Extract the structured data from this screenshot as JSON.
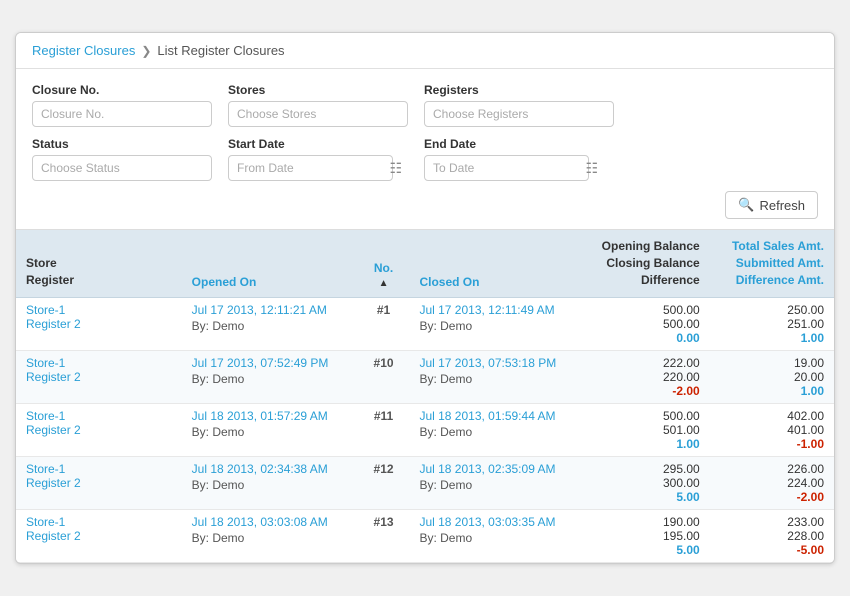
{
  "breadcrumb": {
    "link_label": "Register Closures",
    "separator": "❯",
    "current": "List Register Closures"
  },
  "filters": {
    "closure_no_label": "Closure No.",
    "closure_no_placeholder": "Closure No.",
    "stores_label": "Stores",
    "stores_placeholder": "Choose Stores",
    "registers_label": "Registers",
    "registers_placeholder": "Choose Registers",
    "status_label": "Status",
    "status_placeholder": "Choose Status",
    "start_date_label": "Start Date",
    "start_date_placeholder": "From Date",
    "end_date_label": "End Date",
    "end_date_placeholder": "To Date",
    "refresh_label": "Refresh"
  },
  "table": {
    "headers": {
      "store_register": "Store\nRegister",
      "opened_on": "Opened On",
      "no": "No.",
      "closed_on": "Closed On",
      "balance_lines": [
        "Opening Balance",
        "Closing Balance",
        "Difference"
      ],
      "sales_lines": [
        "Total Sales Amt.",
        "Submitted Amt.",
        "Difference Amt."
      ]
    },
    "rows": [
      {
        "store": "Store-1",
        "register": "Register 2",
        "opened_on": "Jul 17 2013, 12:11:21 AM",
        "opened_by": "By: Demo",
        "no": "#1",
        "closed_on": "Jul 17 2013, 12:11:49 AM",
        "closed_by": "By: Demo",
        "opening_balance": "500.00",
        "closing_balance": "500.00",
        "difference": "0.00",
        "difference_class": "green",
        "total_sales": "250.00",
        "submitted": "251.00",
        "diff_sales": "1.00",
        "diff_sales_class": "blue"
      },
      {
        "store": "Store-1",
        "register": "Register 2",
        "opened_on": "Jul 17 2013, 07:52:49 PM",
        "opened_by": "By: Demo",
        "no": "#10",
        "closed_on": "Jul 17 2013, 07:53:18 PM",
        "closed_by": "By: Demo",
        "opening_balance": "222.00",
        "closing_balance": "220.00",
        "difference": "-2.00",
        "difference_class": "red",
        "total_sales": "19.00",
        "submitted": "20.00",
        "diff_sales": "1.00",
        "diff_sales_class": "blue"
      },
      {
        "store": "Store-1",
        "register": "Register 2",
        "opened_on": "Jul 18 2013, 01:57:29 AM",
        "opened_by": "By: Demo",
        "no": "#11",
        "closed_on": "Jul 18 2013, 01:59:44 AM",
        "closed_by": "By: Demo",
        "opening_balance": "500.00",
        "closing_balance": "501.00",
        "difference": "1.00",
        "difference_class": "green",
        "total_sales": "402.00",
        "submitted": "401.00",
        "diff_sales": "-1.00",
        "diff_sales_class": "red"
      },
      {
        "store": "Store-1",
        "register": "Register 2",
        "opened_on": "Jul 18 2013, 02:34:38 AM",
        "opened_by": "By: Demo",
        "no": "#12",
        "closed_on": "Jul 18 2013, 02:35:09 AM",
        "closed_by": "By: Demo",
        "opening_balance": "295.00",
        "closing_balance": "300.00",
        "difference": "5.00",
        "difference_class": "green",
        "total_sales": "226.00",
        "submitted": "224.00",
        "diff_sales": "-2.00",
        "diff_sales_class": "red"
      },
      {
        "store": "Store-1",
        "register": "Register 2",
        "opened_on": "Jul 18 2013, 03:03:08 AM",
        "opened_by": "By: Demo",
        "no": "#13",
        "closed_on": "Jul 18 2013, 03:03:35 AM",
        "closed_by": "By: Demo",
        "opening_balance": "190.00",
        "closing_balance": "195.00",
        "difference": "5.00",
        "difference_class": "green",
        "total_sales": "233.00",
        "submitted": "228.00",
        "diff_sales": "-5.00",
        "diff_sales_class": "red"
      }
    ]
  }
}
